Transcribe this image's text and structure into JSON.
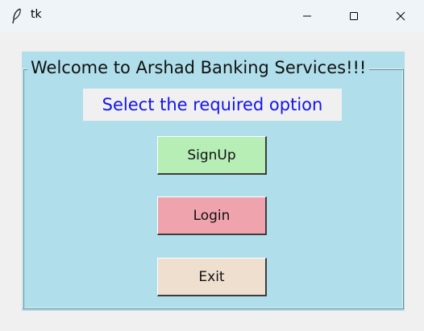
{
  "window": {
    "title": "tk",
    "minimize_symbol": "—",
    "maximize_symbol": "☐",
    "close_symbol": "✕",
    "app_icon": "feather-icon"
  },
  "main": {
    "frame_title": "Welcome to Arshad Banking Services!!!",
    "subtitle": "Select the required option",
    "buttons": {
      "signup_label": "SignUp",
      "login_label": "Login",
      "exit_label": "Exit"
    }
  },
  "colors": {
    "panel_bg": "#b0dfeb",
    "subtitle_text": "#1313f0",
    "signup_bg": "#b7eeb6",
    "login_bg": "#efa4ad",
    "exit_bg": "#efdfcf"
  }
}
